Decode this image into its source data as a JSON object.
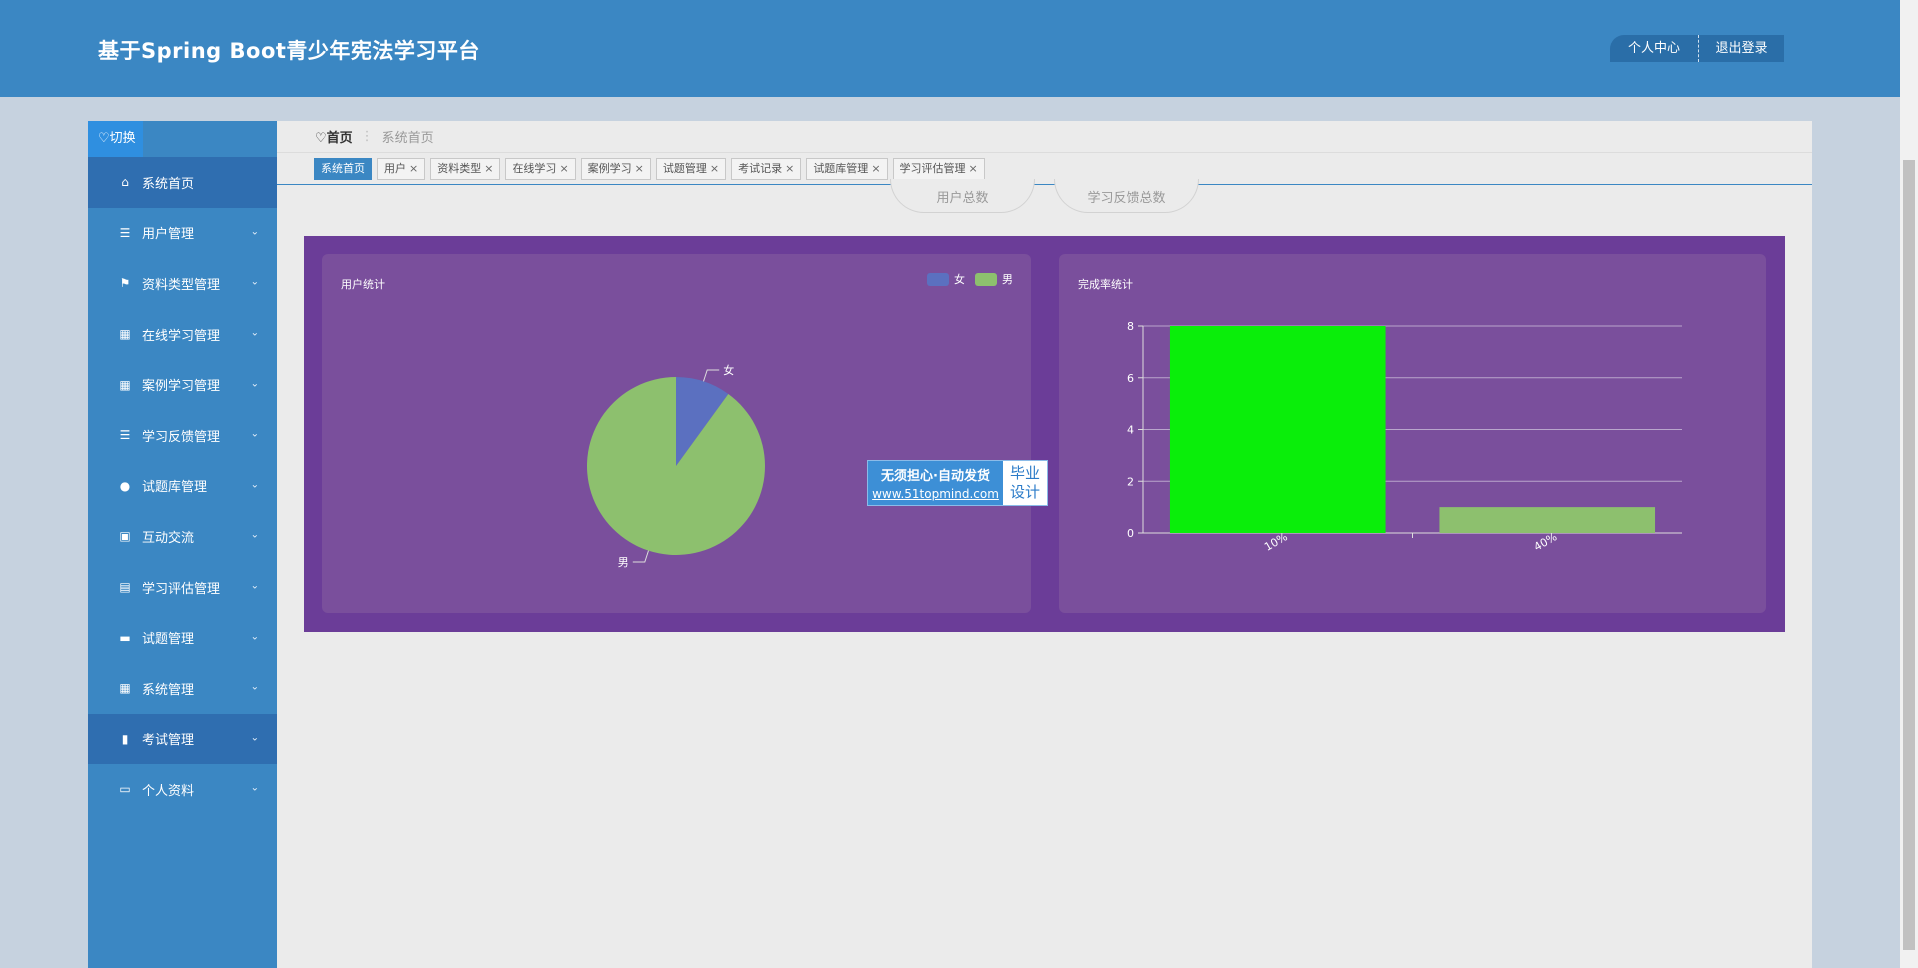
{
  "header": {
    "title": "基于Spring Boot青少年宪法学习平台",
    "buttons": {
      "profile": "个人中心",
      "logout": "退出登录"
    }
  },
  "sidebar": {
    "switch_label": "♡切换",
    "items": [
      {
        "label": "系统首页",
        "icon": "home-icon",
        "glyph": "⌂",
        "active": true,
        "chevron": false
      },
      {
        "label": "用户管理",
        "icon": "list-icon",
        "glyph": "☰",
        "chevron": true
      },
      {
        "label": "资料类型管理",
        "icon": "flag-icon",
        "glyph": "⚑",
        "chevron": true
      },
      {
        "label": "在线学习管理",
        "icon": "grid-icon",
        "glyph": "▦",
        "chevron": true
      },
      {
        "label": "案例学习管理",
        "icon": "grid-icon",
        "glyph": "▦",
        "chevron": true
      },
      {
        "label": "学习反馈管理",
        "icon": "list-icon",
        "glyph": "☰",
        "chevron": true
      },
      {
        "label": "试题库管理",
        "icon": "user-icon",
        "glyph": "●",
        "chevron": true
      },
      {
        "label": "互动交流",
        "icon": "clipboard-icon",
        "glyph": "▣",
        "chevron": true
      },
      {
        "label": "学习评估管理",
        "icon": "chart-line-icon",
        "glyph": "▤",
        "chevron": true
      },
      {
        "label": "试题管理",
        "icon": "brush-icon",
        "glyph": "▬",
        "chevron": true
      },
      {
        "label": "系统管理",
        "icon": "grid-icon",
        "glyph": "▦",
        "chevron": true
      },
      {
        "label": "考试管理",
        "icon": "bar-chart-icon",
        "glyph": "▮",
        "active": true,
        "chevron": true
      },
      {
        "label": "个人资料",
        "icon": "card-icon",
        "glyph": "▭",
        "chevron": true
      }
    ]
  },
  "breadcrumb": {
    "home": "♡首页",
    "separator": "⋮",
    "current": "系统首页"
  },
  "tabs": [
    {
      "label": "系统首页",
      "active": true,
      "closable": false
    },
    {
      "label": "用户",
      "closable": true
    },
    {
      "label": "资料类型",
      "closable": true
    },
    {
      "label": "在线学习",
      "closable": true
    },
    {
      "label": "案例学习",
      "closable": true
    },
    {
      "label": "试题管理",
      "closable": true
    },
    {
      "label": "考试记录",
      "closable": true
    },
    {
      "label": "试题库管理",
      "closable": true
    },
    {
      "label": "学习评估管理",
      "closable": true
    }
  ],
  "stats": {
    "user_total": "用户总数",
    "feedback_total": "学习反馈总数"
  },
  "charts": {
    "pie_title": "用户统计",
    "bar_title": "完成率统计"
  },
  "watermark": {
    "line1": "无须担心·自动发货",
    "line2": "www.51topmind.com",
    "side1": "毕业",
    "side2": "设计"
  },
  "colors": {
    "header": "#3b87c3",
    "panel": "#6b3d98",
    "card": "#7a4f9c",
    "female": "#5b70c0",
    "male": "#8dc06e",
    "bar_highlight": "#0aee0a"
  },
  "chart_data": [
    {
      "type": "pie",
      "title": "用户统计",
      "legend": [
        "女",
        "男"
      ],
      "legend_position": "top-right",
      "slices": [
        {
          "label": "女",
          "value": 1,
          "color": "#5b70c0"
        },
        {
          "label": "男",
          "value": 9,
          "color": "#8dc06e"
        }
      ]
    },
    {
      "type": "bar",
      "title": "完成率统计",
      "categories": [
        "10%",
        "40%"
      ],
      "values": [
        8,
        1
      ],
      "colors": [
        "#0aee0a",
        "#8dc06e"
      ],
      "ylim": [
        0,
        8
      ],
      "yticks": [
        0,
        2,
        4,
        6,
        8
      ],
      "grid": true
    }
  ]
}
